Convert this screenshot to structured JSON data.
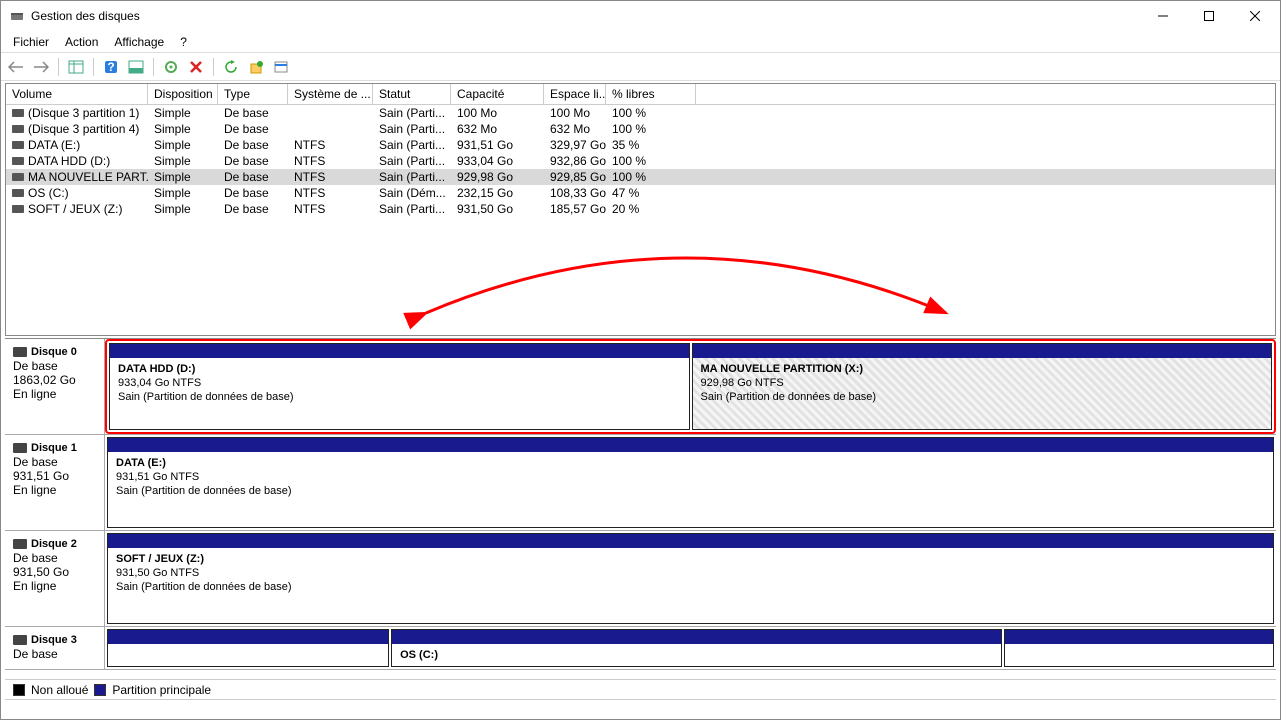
{
  "window": {
    "title": "Gestion des disques"
  },
  "menu": {
    "file": "Fichier",
    "action": "Action",
    "view": "Affichage",
    "help": "?"
  },
  "grid": {
    "headers": {
      "volume": "Volume",
      "layout": "Disposition",
      "type": "Type",
      "filesystem": "Système de ...",
      "status": "Statut",
      "capacity": "Capacité",
      "free": "Espace li...",
      "pct": "% libres"
    },
    "rows": [
      {
        "volume": "(Disque 3 partition 1)",
        "layout": "Simple",
        "type": "De base",
        "fs": "",
        "status": "Sain (Parti...",
        "capacity": "100 Mo",
        "free": "100 Mo",
        "pct": "100 %",
        "selected": false
      },
      {
        "volume": "(Disque 3 partition 4)",
        "layout": "Simple",
        "type": "De base",
        "fs": "",
        "status": "Sain (Parti...",
        "capacity": "632 Mo",
        "free": "632 Mo",
        "pct": "100 %",
        "selected": false
      },
      {
        "volume": "DATA (E:)",
        "layout": "Simple",
        "type": "De base",
        "fs": "NTFS",
        "status": "Sain (Parti...",
        "capacity": "931,51 Go",
        "free": "329,97 Go",
        "pct": "35 %",
        "selected": false
      },
      {
        "volume": "DATA HDD (D:)",
        "layout": "Simple",
        "type": "De base",
        "fs": "NTFS",
        "status": "Sain (Parti...",
        "capacity": "933,04 Go",
        "free": "932,86 Go",
        "pct": "100 %",
        "selected": false
      },
      {
        "volume": "MA NOUVELLE PART...",
        "layout": "Simple",
        "type": "De base",
        "fs": "NTFS",
        "status": "Sain (Parti...",
        "capacity": "929,98 Go",
        "free": "929,85 Go",
        "pct": "100 %",
        "selected": true
      },
      {
        "volume": "OS (C:)",
        "layout": "Simple",
        "type": "De base",
        "fs": "NTFS",
        "status": "Sain (Dém...",
        "capacity": "232,15 Go",
        "free": "108,33 Go",
        "pct": "47 %",
        "selected": false
      },
      {
        "volume": "SOFT / JEUX (Z:)",
        "layout": "Simple",
        "type": "De base",
        "fs": "NTFS",
        "status": "Sain (Parti...",
        "capacity": "931,50 Go",
        "free": "185,57 Go",
        "pct": "20 %",
        "selected": false
      }
    ]
  },
  "disks": [
    {
      "name": "Disque 0",
      "type": "De base",
      "size": "1863,02 Go",
      "status": "En ligne",
      "highlighted": true,
      "partitions": [
        {
          "title": "DATA HDD  (D:)",
          "sub": "933,04 Go NTFS",
          "status": "Sain (Partition de données de base)",
          "hatched": false,
          "flex": 50
        },
        {
          "title": "MA NOUVELLE PARTITION  (X:)",
          "sub": "929,98 Go NTFS",
          "status": "Sain (Partition de données de base)",
          "hatched": true,
          "flex": 50
        }
      ]
    },
    {
      "name": "Disque 1",
      "type": "De base",
      "size": "931,51 Go",
      "status": "En ligne",
      "highlighted": false,
      "partitions": [
        {
          "title": "DATA  (E:)",
          "sub": "931,51 Go NTFS",
          "status": "Sain (Partition de données de base)",
          "hatched": false,
          "flex": 95
        }
      ]
    },
    {
      "name": "Disque 2",
      "type": "De base",
      "size": "931,50 Go",
      "status": "En ligne",
      "highlighted": false,
      "partitions": [
        {
          "title": "SOFT / JEUX  (Z:)",
          "sub": "931,50 Go NTFS",
          "status": "Sain (Partition de données de base)",
          "hatched": false,
          "flex": 95
        }
      ]
    },
    {
      "name": "Disque 3",
      "type": "De base",
      "size": "",
      "status": "",
      "highlighted": false,
      "short": true,
      "partitions": [
        {
          "title": "",
          "sub": "",
          "status": "",
          "hatched": false,
          "flex": 23
        },
        {
          "title": "OS  (C:)",
          "sub": "",
          "status": "",
          "hatched": false,
          "flex": 50
        },
        {
          "title": "",
          "sub": "",
          "status": "",
          "hatched": false,
          "flex": 22
        }
      ]
    }
  ],
  "legend": {
    "unallocated": "Non alloué",
    "primary": "Partition principale"
  }
}
